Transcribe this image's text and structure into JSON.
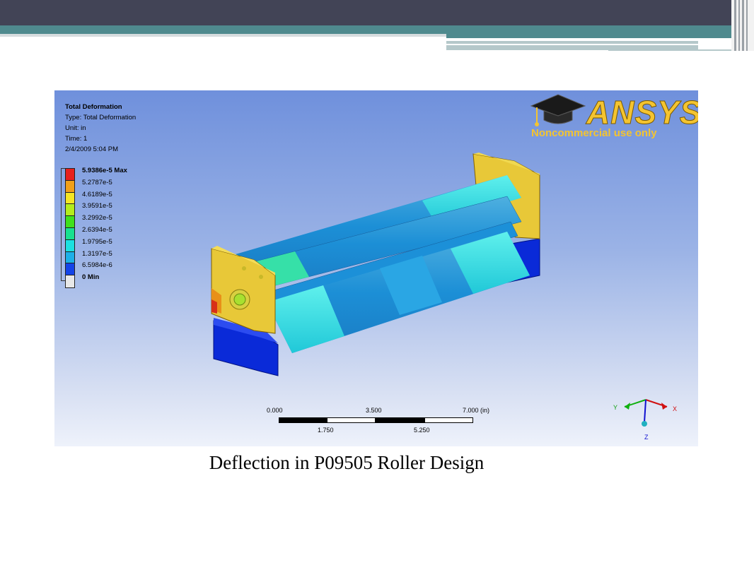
{
  "viewport": {
    "info": {
      "title": "Total Deformation",
      "type": "Type: Total Deformation",
      "unit": "Unit: in",
      "time": "Time: 1",
      "date": "2/4/2009 5:04 PM"
    },
    "legend": [
      {
        "label": "5.9386e-5 Max",
        "color": "#e8201c",
        "bold": true
      },
      {
        "label": "5.2787e-5",
        "color": "#f0a018"
      },
      {
        "label": "4.6189e-5",
        "color": "#f4e624"
      },
      {
        "label": "3.9591e-5",
        "color": "#b4ec1c"
      },
      {
        "label": "3.2992e-5",
        "color": "#40e01c"
      },
      {
        "label": "2.6394e-5",
        "color": "#18e090"
      },
      {
        "label": "1.9795e-5",
        "color": "#1ce0e0"
      },
      {
        "label": "1.3197e-5",
        "color": "#1cb0e8"
      },
      {
        "label": "6.5984e-6",
        "color": "#1444e8"
      },
      {
        "label": "0 Min",
        "color": "#e8e8e8",
        "bold": true
      }
    ],
    "logo": {
      "word": "ANSYS",
      "tagline": "Noncommercial use only"
    },
    "scale": {
      "top_labels": [
        "0.000",
        "3.500",
        "7.000 (in)"
      ],
      "bottom_labels": [
        "1.750",
        "5.250"
      ]
    },
    "triad": {
      "x": "X",
      "y": "Y",
      "z": "Z"
    }
  },
  "caption": "Deflection in P09505 Roller Design",
  "colors": {
    "header_dark": "#424456",
    "header_teal": "#4f8a8e",
    "logo_gold": "#f4c430"
  }
}
